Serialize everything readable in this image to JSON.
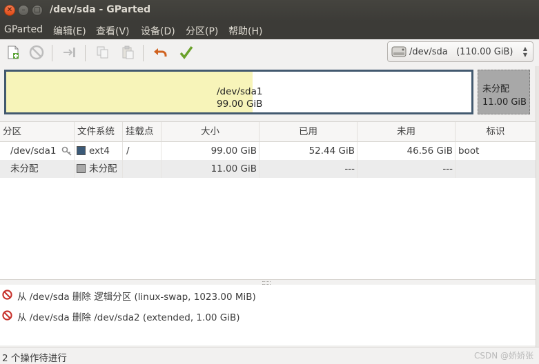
{
  "window": {
    "title": "/dev/sda - GParted"
  },
  "menubar": {
    "items": [
      "GParted",
      "编辑(E)",
      "查看(V)",
      "设备(D)",
      "分区(P)",
      "帮助(H)"
    ]
  },
  "toolbar": {
    "icons": [
      "new-partition-icon",
      "delete-icon",
      "resize-move-icon",
      "copy-icon",
      "paste-icon",
      "undo-icon",
      "apply-icon"
    ]
  },
  "device_selector": {
    "value": "/dev/sda   (110.00 GiB)"
  },
  "disk_map": {
    "main": {
      "name": "/dev/sda1",
      "size": "99.00 GiB",
      "used_fraction": 0.53
    },
    "unallocated": {
      "name": "未分配",
      "size": "11.00 GiB"
    }
  },
  "table": {
    "columns": [
      "分区",
      "文件系统",
      "挂载点",
      "大小",
      "已用",
      "未用",
      "标识"
    ],
    "rows": [
      {
        "partition": "/dev/sda1",
        "filesystem": "ext4",
        "fs_color": "#3b5a78",
        "mount": "/",
        "size": "99.00 GiB",
        "used": "52.44 GiB",
        "unused": "46.56 GiB",
        "flags": "boot"
      },
      {
        "partition": "未分配",
        "filesystem": "未分配",
        "fs_color": "#a8a8a8",
        "mount": "",
        "size": "11.00 GiB",
        "used": "---",
        "unused": "---",
        "flags": ""
      }
    ]
  },
  "operations": [
    "从 /dev/sda 删除 逻辑分区 (linux-swap, 1023.00 MiB)",
    "从 /dev/sda 删除 /dev/sda2 (extended, 1.00 GiB)"
  ],
  "status": {
    "text": "2 个操作待进行",
    "watermark": "CSDN @娇娇张"
  }
}
